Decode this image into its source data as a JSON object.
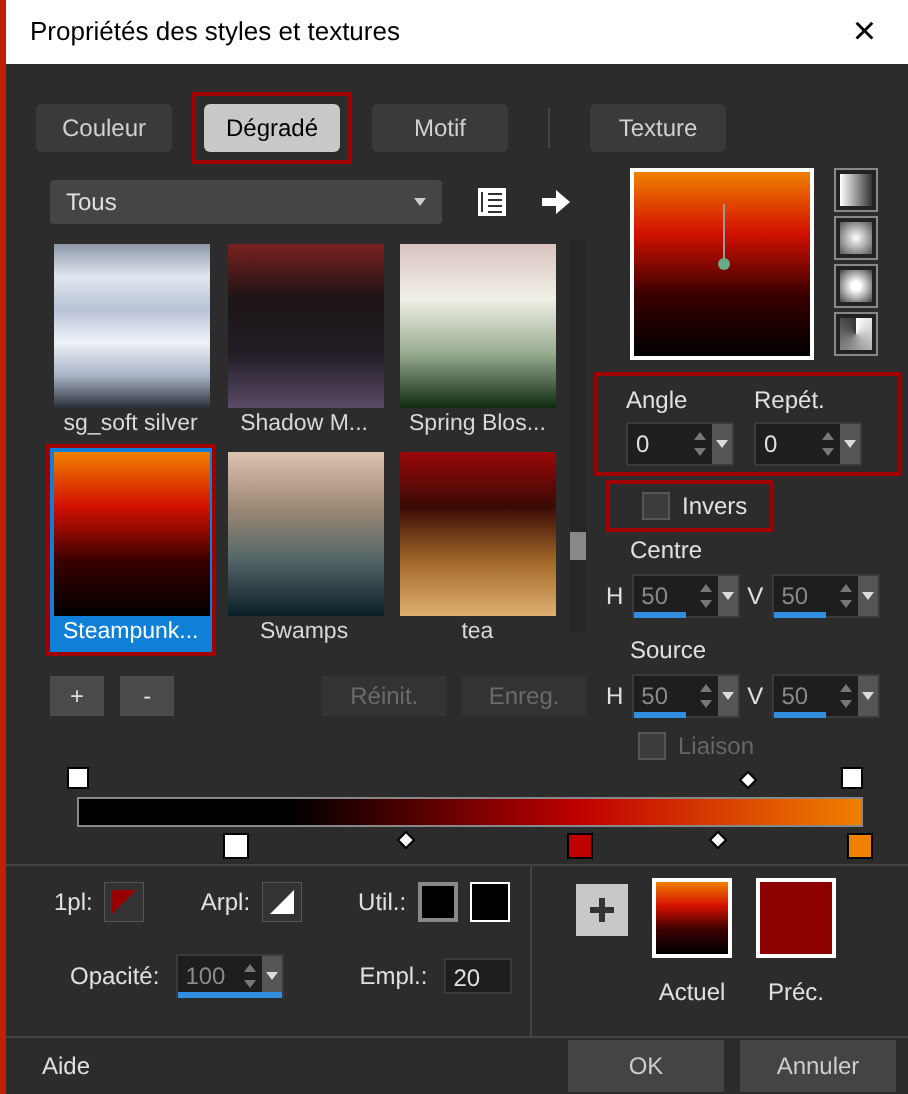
{
  "window": {
    "title": "Propriétés des styles et textures",
    "close": "×"
  },
  "tabs": [
    {
      "label": "Couleur",
      "selected": false,
      "highlighted": false
    },
    {
      "label": "Dégradé",
      "selected": true,
      "highlighted": true
    },
    {
      "label": "Motif",
      "selected": false,
      "highlighted": false
    },
    {
      "label": "Texture",
      "selected": false,
      "highlighted": false
    }
  ],
  "category": {
    "value": "Tous"
  },
  "gradients": [
    {
      "name": "sg_soft silver",
      "selected": false,
      "highlighted": false
    },
    {
      "name": "Shadow M...",
      "selected": false,
      "highlighted": false
    },
    {
      "name": "Spring Blos...",
      "selected": false,
      "highlighted": false
    },
    {
      "name": "Steampunk...",
      "selected": true,
      "highlighted": true
    },
    {
      "name": "Swamps",
      "selected": false,
      "highlighted": false
    },
    {
      "name": "tea",
      "selected": false,
      "highlighted": false
    }
  ],
  "list_buttons": [
    "+",
    "-"
  ],
  "action_buttons": [
    {
      "label": "Réinit.",
      "disabled": true
    },
    {
      "label": "Enreg.",
      "disabled": true
    }
  ],
  "angle": {
    "label": "Angle",
    "value": "0"
  },
  "repeat": {
    "label": "Repét.",
    "value": "0"
  },
  "angle_group_highlighted": true,
  "invert": {
    "label": "Invers",
    "checked": false,
    "highlighted": true
  },
  "centre": {
    "label": "Centre",
    "h": {
      "label": "H",
      "value": "50",
      "level": 0.5
    },
    "v": {
      "label": "V",
      "value": "50",
      "level": 0.5
    }
  },
  "source": {
    "label": "Source",
    "h": {
      "label": "H",
      "value": "50",
      "level": 0.5
    },
    "v": {
      "label": "V",
      "value": "50",
      "level": 0.5
    }
  },
  "link": {
    "label": "Liaison",
    "checked": false,
    "disabled": true
  },
  "fg_label": "1pl:",
  "bg_label": "Arpl:",
  "use_label": "Util.:",
  "opacity": {
    "label": "Opacité:",
    "value": "100",
    "level": 1
  },
  "location": {
    "label": "Empl.:",
    "value": "20"
  },
  "current_label": "Actuel",
  "previous_label": "Préc.",
  "help": "Aide",
  "buttons": [
    "OK",
    "Annuler"
  ]
}
